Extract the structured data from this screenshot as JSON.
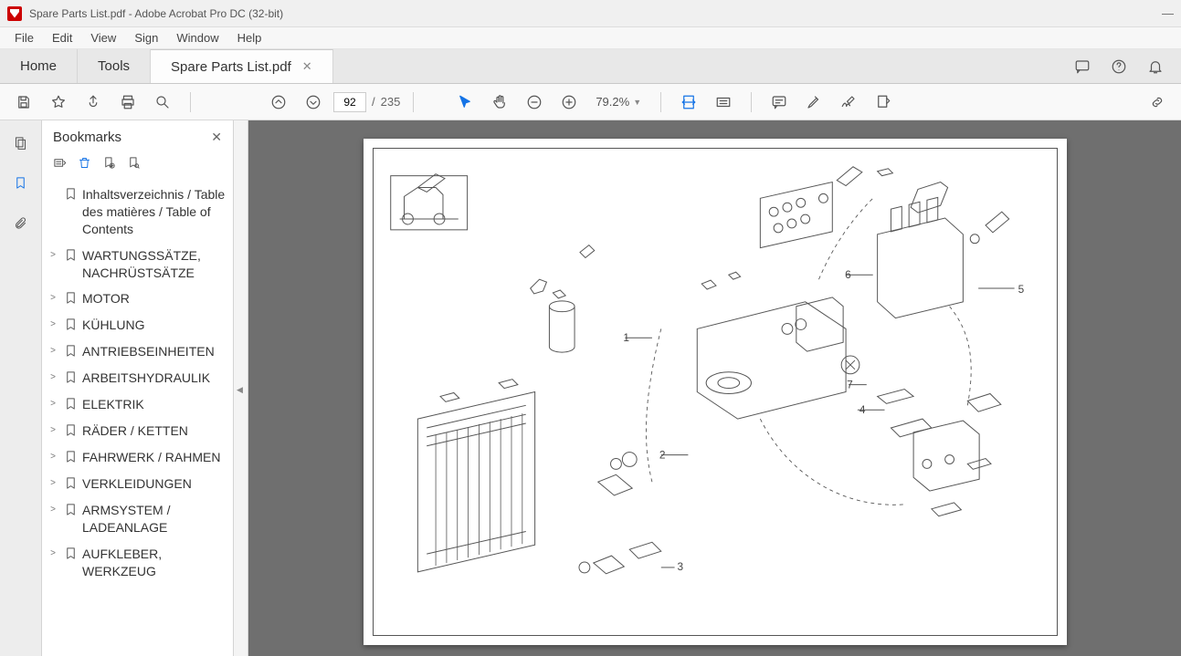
{
  "window": {
    "title": "Spare Parts List.pdf - Adobe Acrobat Pro DC (32-bit)"
  },
  "menu": {
    "items": [
      "File",
      "Edit",
      "View",
      "Sign",
      "Window",
      "Help"
    ]
  },
  "tabs": {
    "home": "Home",
    "tools": "Tools",
    "doc": "Spare Parts List.pdf"
  },
  "toolbar": {
    "page_current": "92",
    "page_sep": "/",
    "page_total": "235",
    "zoom": "79.2%"
  },
  "panel": {
    "title": "Bookmarks"
  },
  "bookmarks": [
    {
      "expand": "",
      "label": "Inhaltsverzeichnis / Table des matières / Table of Contents"
    },
    {
      "expand": ">",
      "label": "WARTUNGSSÄTZE, NACHRÜSTSÄTZE"
    },
    {
      "expand": ">",
      "label": "MOTOR"
    },
    {
      "expand": ">",
      "label": "KÜHLUNG"
    },
    {
      "expand": ">",
      "label": "ANTRIEBSEINHEITEN"
    },
    {
      "expand": ">",
      "label": "ARBEITSHYDRAULIK"
    },
    {
      "expand": ">",
      "label": "ELEKTRIK"
    },
    {
      "expand": ">",
      "label": "RÄDER / KETTEN"
    },
    {
      "expand": ">",
      "label": "FAHRWERK / RAHMEN"
    },
    {
      "expand": ">",
      "label": "VERKLEIDUNGEN"
    },
    {
      "expand": ">",
      "label": "ARMSYSTEM / LADEANLAGE"
    },
    {
      "expand": ">",
      "label": "AUFKLEBER, WERKZEUG"
    }
  ],
  "diagram": {
    "callouts": [
      "1",
      "2",
      "3",
      "4",
      "5",
      "6",
      "7"
    ]
  }
}
